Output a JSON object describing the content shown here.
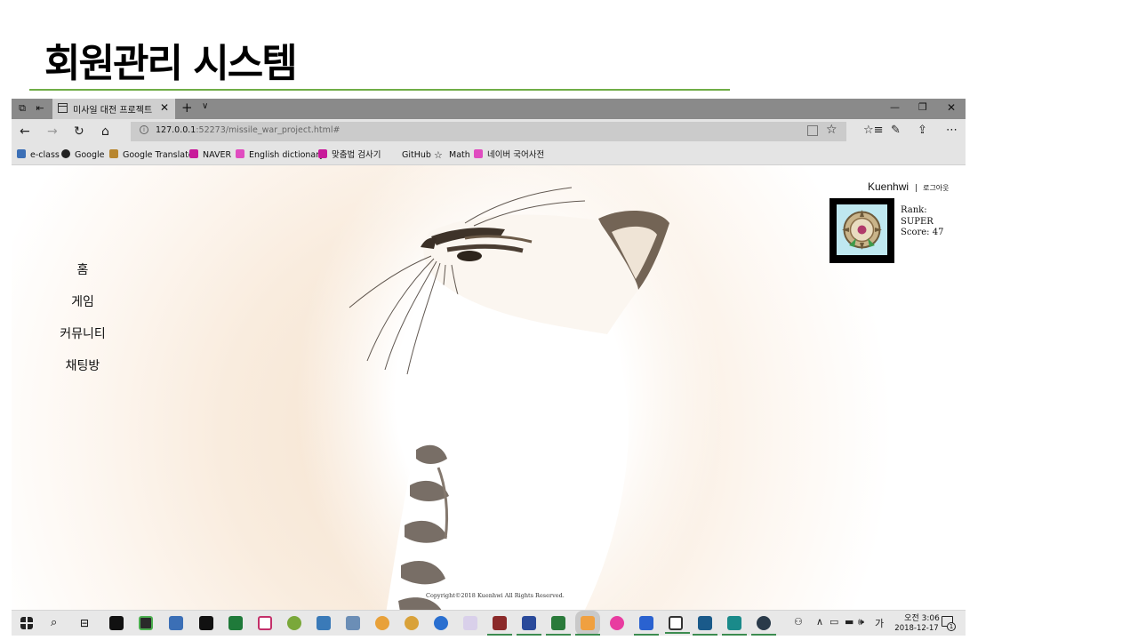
{
  "slide": {
    "title": "회원관리 시스템",
    "accent_color": "#70ad47"
  },
  "browser": {
    "tab_title": "미사일 대전 프로젝트",
    "url_host": "127.0.0.1",
    "url_path": ":52273/missile_war_project.html#",
    "favorites": [
      {
        "label": "e-class",
        "icon": "eclass-icon",
        "color": "#3b6fb6"
      },
      {
        "label": "Google",
        "icon": "google-icon",
        "color": "#222222"
      },
      {
        "label": "Google Translate",
        "icon": "folder-icon",
        "color": "#b8862e"
      },
      {
        "label": "NAVER",
        "icon": "naver-icon",
        "color": "#c8199a"
      },
      {
        "label": "English dictionary",
        "icon": "folder-icon",
        "color": "#e04cc0"
      },
      {
        "label": "맞춤법 검사기",
        "icon": "naver-icon",
        "color": "#c8199a"
      },
      {
        "label": "GitHub",
        "icon": "github-icon",
        "color": "#e4e4e4"
      },
      {
        "label": "Math",
        "icon": "star-icon",
        "color": "#222222"
      },
      {
        "label": "네이버 국어사전",
        "icon": "folder-icon",
        "color": "#e04cc0"
      }
    ]
  },
  "page": {
    "menu": [
      "홈",
      "게임",
      "커뮤니티",
      "채팅방"
    ],
    "user": {
      "name": "Kuenhwi",
      "separator": "|",
      "logout": "로그아웃",
      "rank_label": "Rank:",
      "rank_value": "SUPER",
      "score": "Score: 47"
    },
    "copyright": "Copyright©2018 Kuenhwi All Rights Reserved."
  },
  "taskbar": {
    "time": "오전 3:06",
    "date": "2018-12-17",
    "ime": "가",
    "notification_count": "1"
  }
}
